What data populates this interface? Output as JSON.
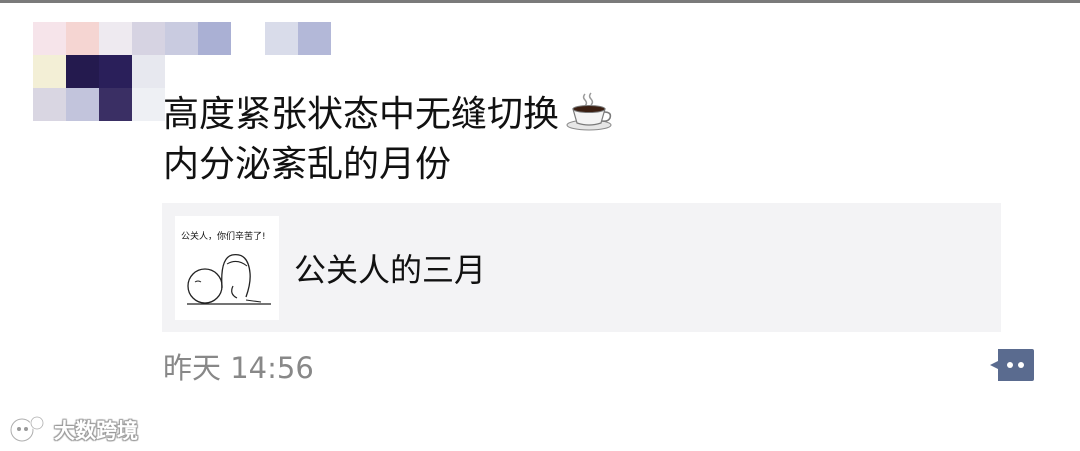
{
  "post": {
    "lines": [
      "高度紧张状态中无缝切换",
      "内分泌紊乱的月份"
    ],
    "emoji_icon": "coffee-cup-icon"
  },
  "link": {
    "thumbnail_caption": "公关人，你们辛苦了!",
    "title": "公关人的三月"
  },
  "meta": {
    "time": "昨天 14:56"
  },
  "comment_button": {
    "icon": "comment-icon",
    "accent": "#5a6b8f"
  },
  "watermark": {
    "text": "大数跨境"
  }
}
